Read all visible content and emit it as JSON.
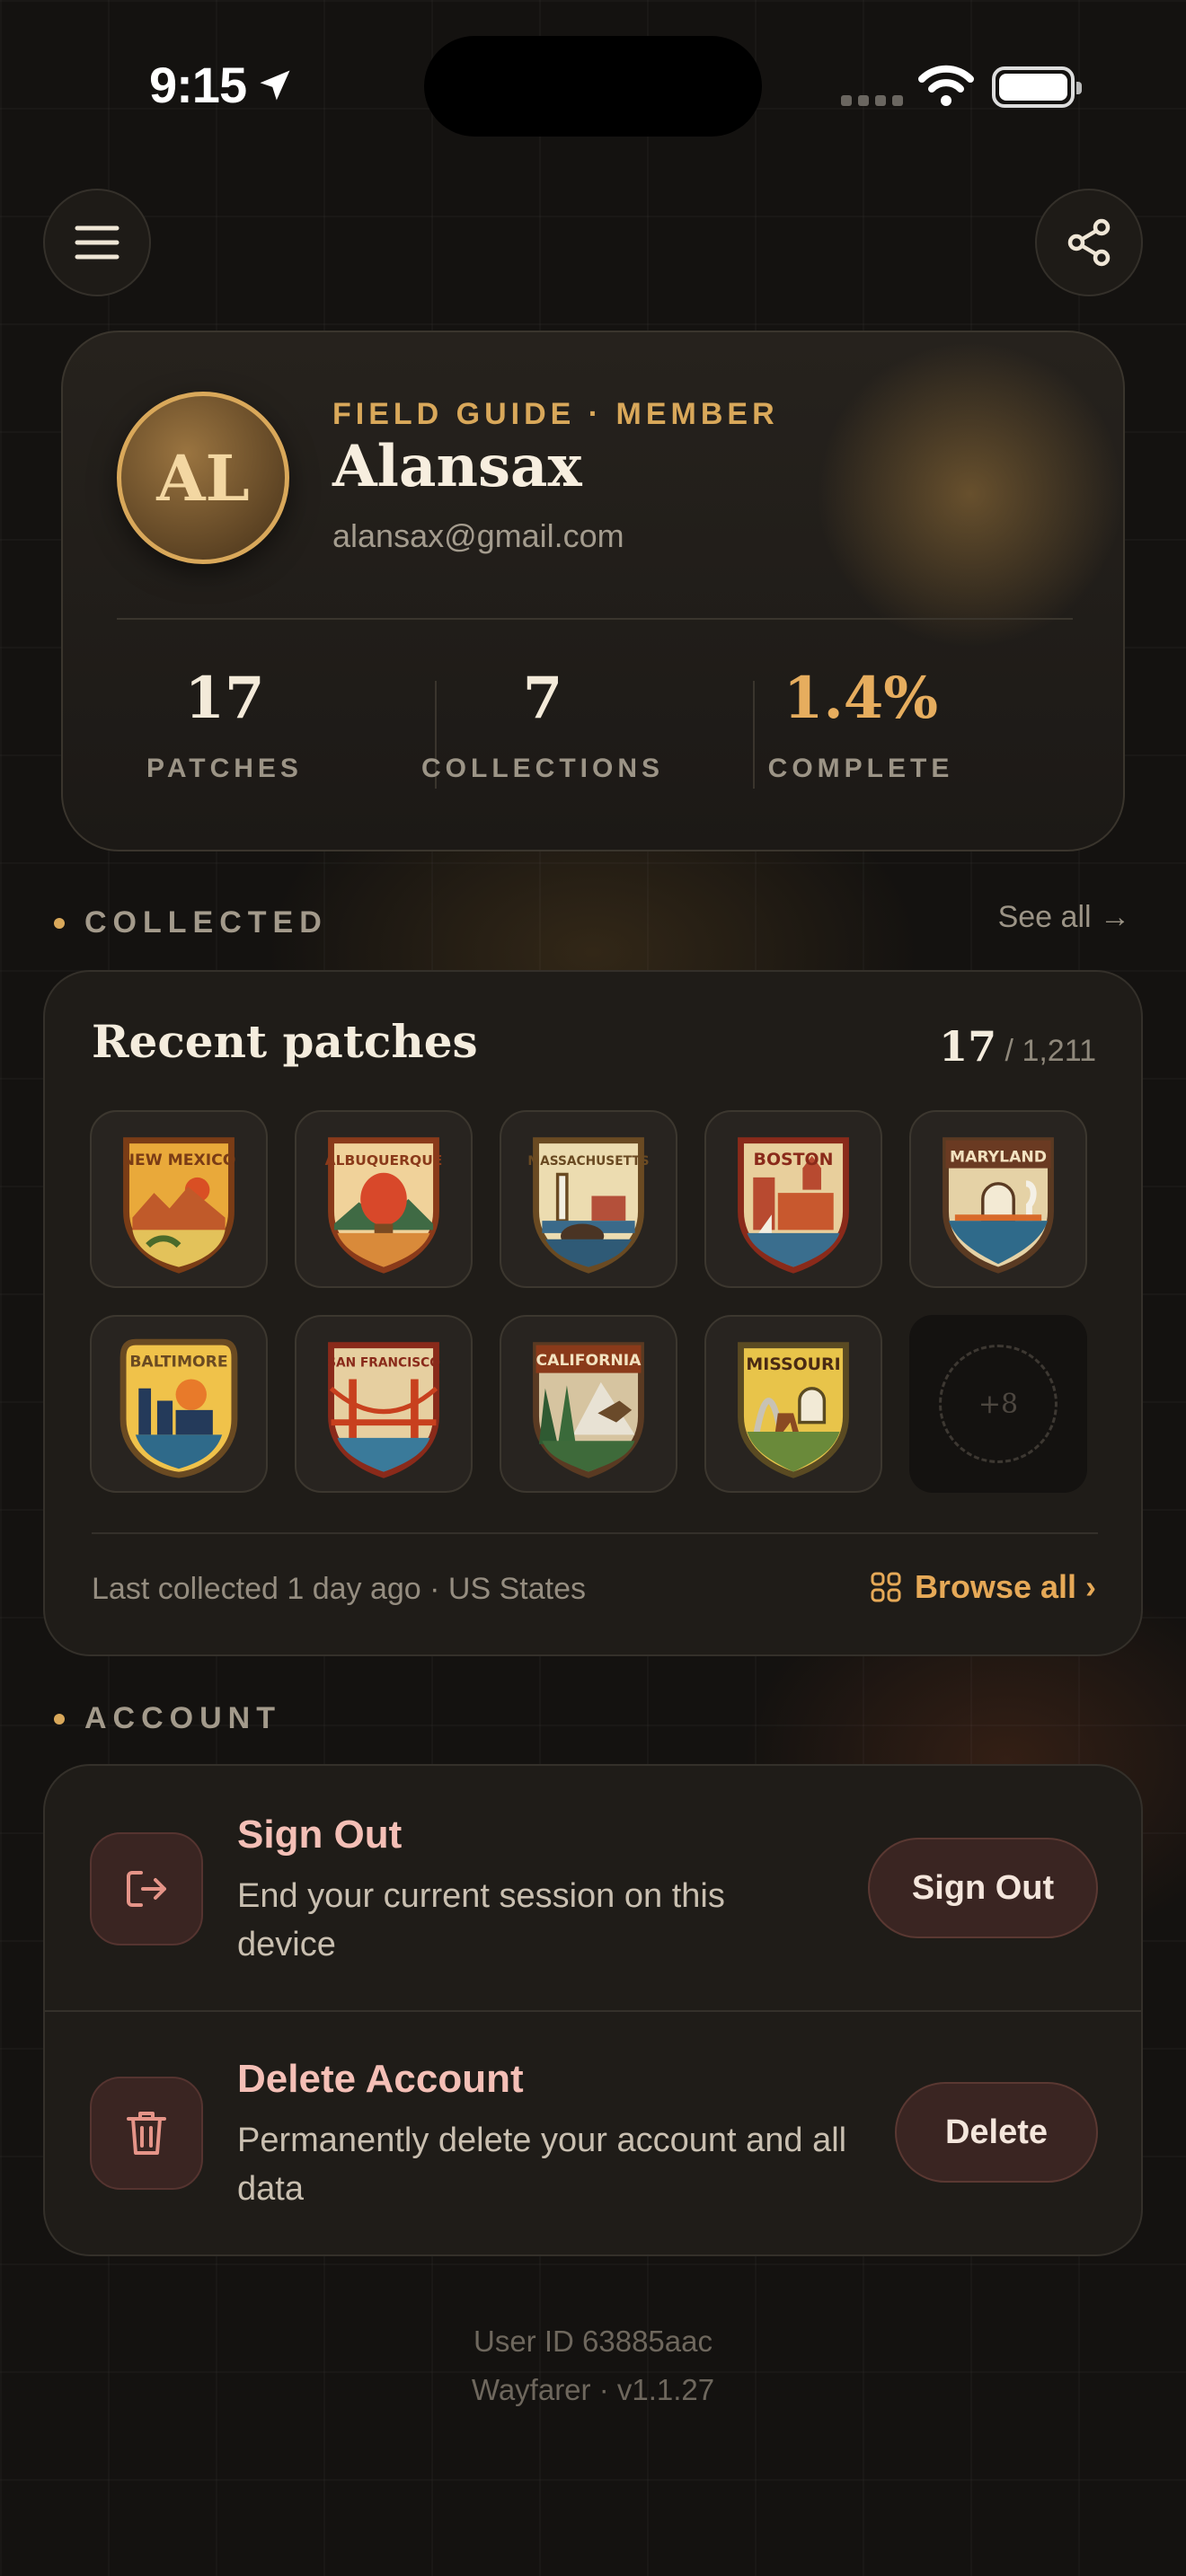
{
  "status_bar": {
    "time": "9:15"
  },
  "profile": {
    "initials": "AL",
    "eyebrow": "FIELD GUIDE · MEMBER",
    "name": "Alansax",
    "email": "alansax@gmail.com",
    "stats": [
      {
        "value": "17",
        "label": "PATCHES"
      },
      {
        "value": "7",
        "label": "COLLECTIONS"
      },
      {
        "value": "1.4%",
        "label": "COMPLETE"
      }
    ]
  },
  "collected": {
    "heading": "COLLECTED",
    "see_all": "See all →",
    "card_title": "Recent patches",
    "count": "17",
    "total": "/ 1,211",
    "patches": [
      {
        "name": "NEW MEXICO",
        "icon": "new-mexico-patch-icon"
      },
      {
        "name": "ALBUQUERQUE",
        "icon": "albuquerque-patch-icon"
      },
      {
        "name": "MASSACHUSETTS",
        "icon": "massachusetts-patch-icon"
      },
      {
        "name": "BOSTON",
        "icon": "boston-patch-icon"
      },
      {
        "name": "MARYLAND",
        "icon": "maryland-patch-icon"
      },
      {
        "name": "BALTIMORE",
        "icon": "baltimore-patch-icon"
      },
      {
        "name": "SAN FRANCISCO",
        "icon": "san-francisco-patch-icon"
      },
      {
        "name": "CALIFORNIA",
        "icon": "california-patch-icon"
      },
      {
        "name": "MISSOURI",
        "icon": "missouri-patch-icon"
      }
    ],
    "more_label": "+8",
    "last_collected": "Last collected 1 day ago · US States",
    "browse_all": "Browse all ›"
  },
  "account": {
    "heading": "ACCOUNT",
    "sign_out": {
      "title": "Sign Out",
      "desc": "End your current session on this device",
      "button": "Sign Out"
    },
    "delete": {
      "title": "Delete Account",
      "desc": "Permanently delete your account and all data",
      "button": "Delete"
    }
  },
  "footer": {
    "user_id": "User ID 63885aac",
    "version": "Wayfarer · v1.1.27"
  },
  "colors": {
    "accent": "#d9a85a",
    "danger_text": "#f4bfb6",
    "background": "#141210"
  }
}
